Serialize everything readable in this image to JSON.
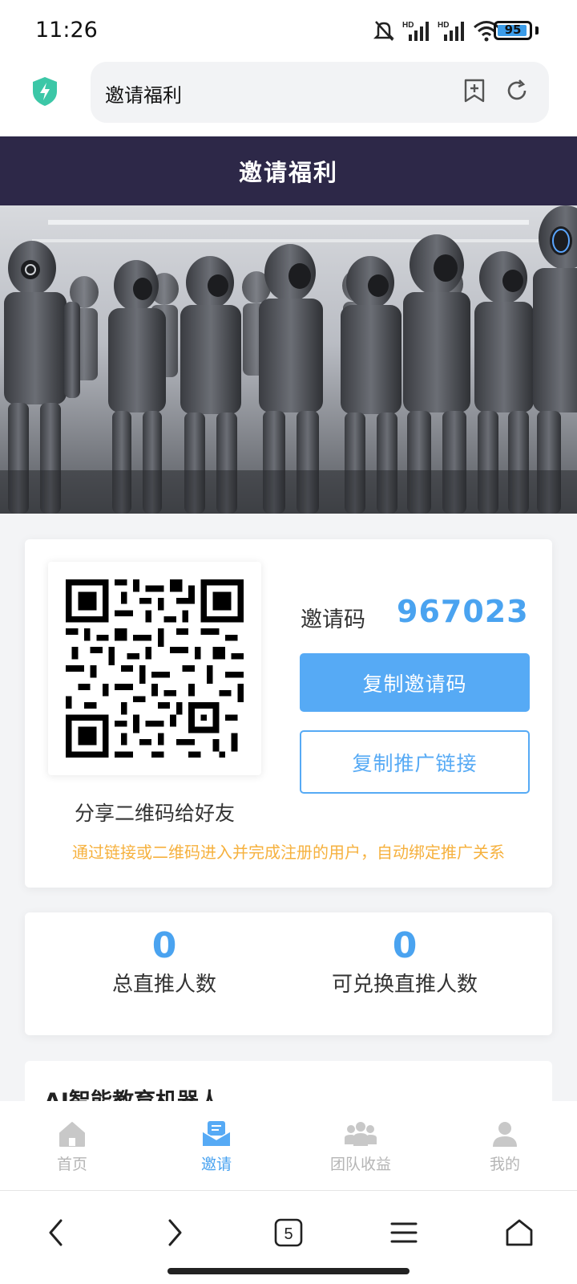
{
  "status_bar": {
    "time": "11:26",
    "battery_level": "95",
    "network_labels": [
      "HD",
      "HD"
    ],
    "icons": [
      "bell-muted-icon",
      "signal-icon",
      "signal-icon",
      "wifi-icon",
      "battery-icon"
    ]
  },
  "browser": {
    "address_text": "邀请福利",
    "icons": [
      "shield-bolt-icon",
      "bookmark-add-icon",
      "reload-icon"
    ]
  },
  "header": {
    "title": "邀请福利",
    "background_color": "#2d2848"
  },
  "invite": {
    "qr_caption": "分享二维码给好友",
    "code_label": "邀请码",
    "code_value": "967023",
    "copy_code_label": "复制邀请码",
    "copy_link_label": "复制推广链接",
    "note": "通过链接或二维码进入并完成注册的用户，自动绑定推广关系",
    "accent_color": "#56aaf5",
    "note_color": "#f6b13e"
  },
  "stats": {
    "items": [
      {
        "value": "0",
        "label": "总直推人数"
      },
      {
        "value": "0",
        "label": "可兑换直推人数"
      }
    ]
  },
  "product": {
    "title": "AI智能教育机器人"
  },
  "tabbar": {
    "items": [
      {
        "label": "首页",
        "icon": "home-icon",
        "active": false
      },
      {
        "label": "邀请",
        "icon": "invite-mail-icon",
        "active": true
      },
      {
        "label": "团队收益",
        "icon": "team-icon",
        "active": false
      },
      {
        "label": "我的",
        "icon": "user-icon",
        "active": false
      }
    ]
  },
  "system_nav": {
    "tab_count": "5",
    "icons": [
      "back-icon",
      "forward-icon",
      "tabs-icon",
      "menu-icon",
      "home-icon"
    ]
  }
}
